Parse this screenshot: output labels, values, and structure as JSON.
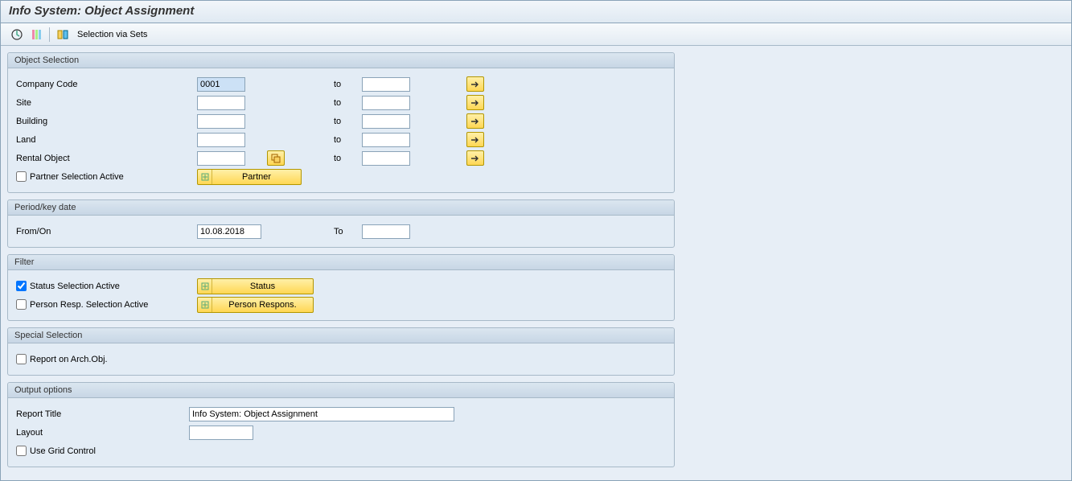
{
  "title": "Info System: Object Assignment",
  "toolbar": {
    "selection_via_sets": "Selection via Sets"
  },
  "objectSelection": {
    "title": "Object Selection",
    "companyCode": {
      "label": "Company Code",
      "from": "0001",
      "to": ""
    },
    "site": {
      "label": "Site",
      "from": "",
      "to": ""
    },
    "building": {
      "label": "Building",
      "from": "",
      "to": ""
    },
    "land": {
      "label": "Land",
      "from": "",
      "to": ""
    },
    "rentalObject": {
      "label": "Rental Object",
      "from": "",
      "to": ""
    },
    "partnerSelActive": {
      "label": "Partner Selection Active",
      "checked": false
    },
    "partnerBtn": "Partner",
    "toLabel": "to"
  },
  "periodKeyDate": {
    "title": "Period/key date",
    "fromOn": {
      "label": "From/On",
      "value": "10.08.2018"
    },
    "toLabel": "To",
    "to": ""
  },
  "filter": {
    "title": "Filter",
    "statusSelActive": {
      "label": "Status Selection Active",
      "checked": true
    },
    "statusBtn": "Status",
    "personRespSelActive": {
      "label": "Person Resp. Selection Active",
      "checked": false
    },
    "personResponsBtn": "Person Respons."
  },
  "specialSelection": {
    "title": "Special Selection",
    "reportOnArchObj": {
      "label": "Report on Arch.Obj.",
      "checked": false
    }
  },
  "outputOptions": {
    "title": "Output options",
    "reportTitle": {
      "label": "Report Title",
      "value": "Info System: Object Assignment"
    },
    "layout": {
      "label": "Layout",
      "value": ""
    },
    "useGridControl": {
      "label": "Use Grid Control",
      "checked": false
    }
  }
}
